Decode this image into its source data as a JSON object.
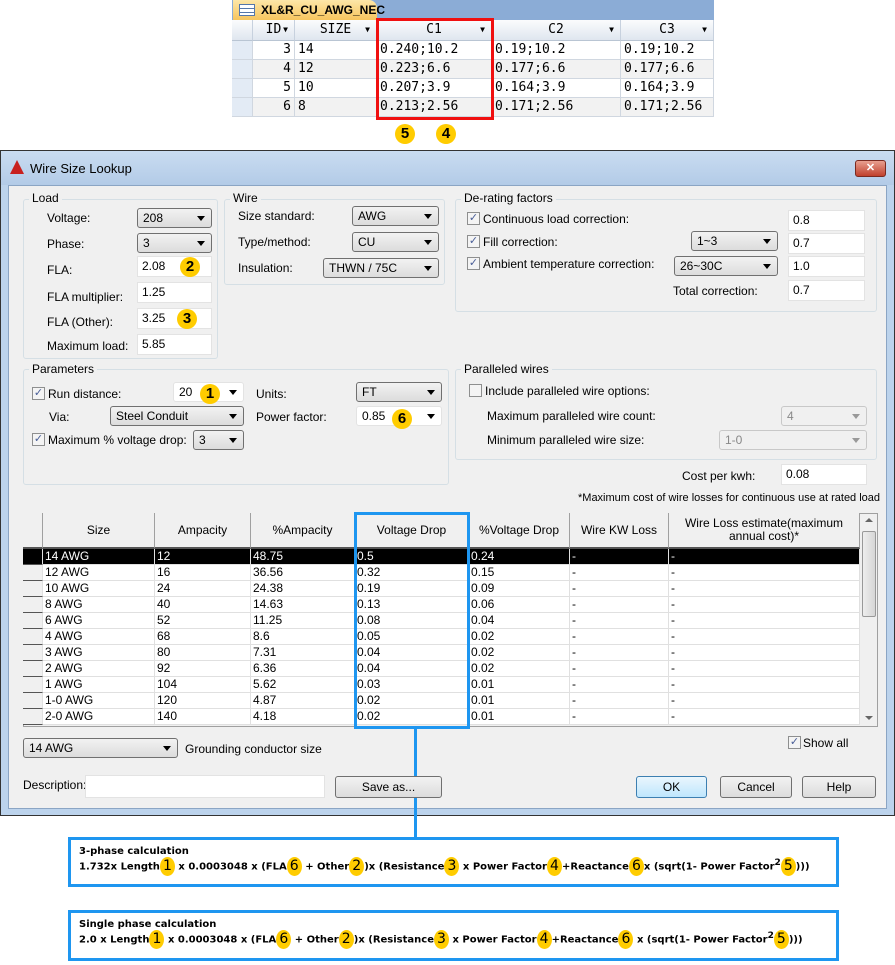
{
  "access": {
    "tab": "XL&R_CU_AWG_NEC",
    "columns": [
      "ID",
      "SIZE",
      "C1",
      "C2",
      "C3"
    ],
    "rows": [
      [
        "3",
        "14",
        "0.240;10.2",
        "0.19;10.2",
        "0.19;10.2"
      ],
      [
        "4",
        "12",
        "0.223;6.6",
        "0.177;6.6",
        "0.177;6.6"
      ],
      [
        "5",
        "10",
        "0.207;3.9",
        "0.164;3.9",
        "0.164;3.9"
      ],
      [
        "6",
        "8",
        "0.213;2.56",
        "0.171;2.56",
        "0.171;2.56"
      ]
    ],
    "badges": [
      "5",
      "4"
    ]
  },
  "dialog": {
    "title": "Wire Size Lookup",
    "close": "✕",
    "load": {
      "legend": "Load",
      "voltage_label": "Voltage:",
      "voltage": "208",
      "phase_label": "Phase:",
      "phase": "3",
      "fla_label": "FLA:",
      "fla": "2.08",
      "fla_badge": "2",
      "mult_label": "FLA multiplier:",
      "mult": "1.25",
      "other_label": "FLA (Other):",
      "other": "3.25",
      "other_badge": "3",
      "max_label": "Maximum load:",
      "max": "5.85"
    },
    "wire": {
      "legend": "Wire",
      "std_label": "Size standard:",
      "std": "AWG",
      "type_label": "Type/method:",
      "type": "CU",
      "ins_label": "Insulation:",
      "ins": "THWN / 75C"
    },
    "derating": {
      "legend": "De-rating factors",
      "cont_label": "Continuous load correction:",
      "cont": "0.8",
      "fill_label": "Fill correction:",
      "fill_sel": "1~3",
      "fill": "0.7",
      "amb_label": "Ambient temperature correction:",
      "amb_sel": "26~30C",
      "amb": "1.0",
      "total_label": "Total correction:",
      "total": "0.7"
    },
    "params": {
      "legend": "Parameters",
      "run_label": "Run distance:",
      "run": "20",
      "run_badge": "1",
      "units_label": "Units:",
      "units": "FT",
      "via_label": "Via:",
      "via": "Steel Conduit",
      "pf_label": "Power factor:",
      "pf": "0.85",
      "pf_badge": "6",
      "vd_label": "Maximum % voltage drop:",
      "vd": "3"
    },
    "parallel": {
      "legend": "Paralleled wires",
      "include_label": "Include paralleled wire options:",
      "count_label": "Maximum paralleled wire count:",
      "count": "4",
      "size_label": "Minimum paralleled wire size:",
      "size": "1-0"
    },
    "cost_label": "Cost per kwh:",
    "cost": "0.08",
    "note": "*Maximum cost of wire losses for continuous use at rated load",
    "grid": {
      "columns": [
        "Size",
        "Ampacity",
        "%Ampacity",
        "Voltage Drop",
        "%Voltage Drop",
        "Wire KW Loss",
        "Wire Loss estimate(maximum annual cost)*"
      ],
      "rows": [
        [
          "14 AWG",
          "12",
          "48.75",
          "0.5",
          "0.24",
          "-",
          "-"
        ],
        [
          "12 AWG",
          "16",
          "36.56",
          "0.32",
          "0.15",
          "-",
          "-"
        ],
        [
          "10 AWG",
          "24",
          "24.38",
          "0.19",
          "0.09",
          "-",
          "-"
        ],
        [
          "8 AWG",
          "40",
          "14.63",
          "0.13",
          "0.06",
          "-",
          "-"
        ],
        [
          "6 AWG",
          "52",
          "11.25",
          "0.08",
          "0.04",
          "-",
          "-"
        ],
        [
          "4 AWG",
          "68",
          "8.6",
          "0.05",
          "0.02",
          "-",
          "-"
        ],
        [
          "3 AWG",
          "80",
          "7.31",
          "0.04",
          "0.02",
          "-",
          "-"
        ],
        [
          "2 AWG",
          "92",
          "6.36",
          "0.04",
          "0.02",
          "-",
          "-"
        ],
        [
          "1 AWG",
          "104",
          "5.62",
          "0.03",
          "0.01",
          "-",
          "-"
        ],
        [
          "1-0 AWG",
          "120",
          "4.87",
          "0.02",
          "0.01",
          "-",
          "-"
        ],
        [
          "2-0 AWG",
          "140",
          "4.18",
          "0.02",
          "0.01",
          "-",
          "-"
        ]
      ]
    },
    "ground": "14 AWG",
    "ground_label": "Grounding conductor size",
    "show_all": "Show all",
    "desc_label": "Description:",
    "desc": "",
    "save": "Save as...",
    "ok": "OK",
    "cancel": "Cancel",
    "help": "Help"
  },
  "formulas": [
    {
      "title": "3-phase calculation",
      "parts": [
        "1.732x Length",
        "1",
        " x 0.0003048 x (FLA",
        "6",
        " + Other",
        "2",
        ")x (Resistance",
        "3",
        " x Power Factor",
        "4",
        "+Reactance",
        "6",
        "x (sqrt(1- Power Factor",
        "2",
        "5",
        ")))"
      ]
    },
    {
      "title": "Single phase calculation",
      "parts": [
        "2.0 x Length",
        "1",
        " x 0.0003048 x (FLA",
        "6",
        " + Other",
        "2",
        ")x (Resistance",
        "3",
        " x Power Factor",
        "4",
        "+Reactance",
        "6",
        " x (sqrt(1- Power Factor",
        "2",
        "5",
        ")))"
      ]
    }
  ]
}
